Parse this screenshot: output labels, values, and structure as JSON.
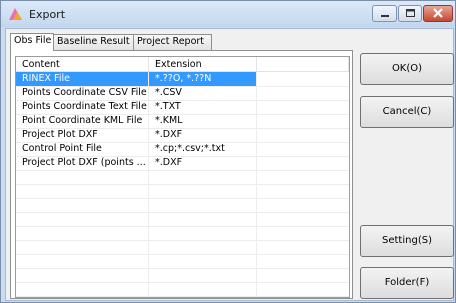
{
  "window": {
    "title": "Export"
  },
  "tabs": [
    "Obs File",
    "Baseline Result",
    "Project Report"
  ],
  "active_tab": 0,
  "list": {
    "columns": [
      "Content",
      "Extension"
    ],
    "rows": [
      {
        "content": "RINEX File",
        "extension": "*.??O, *.??N",
        "selected": true
      },
      {
        "content": "Points Coordinate CSV File",
        "extension": "*.CSV"
      },
      {
        "content": "Points Coordinate Text File",
        "extension": "*.TXT"
      },
      {
        "content": "Point Coordinate KML File",
        "extension": "*.KML"
      },
      {
        "content": "Project Plot DXF",
        "extension": "*.DXF"
      },
      {
        "content": "Control Point File",
        "extension": "*.cp;*.csv;*.txt"
      },
      {
        "content": "Project Plot DXF (points ...",
        "extension": "*.DXF"
      }
    ]
  },
  "buttons": {
    "ok": "OK(O)",
    "cancel": "Cancel(C)",
    "setting": "Setting(S)",
    "folder": "Folder(F)"
  },
  "colors": {
    "selection": "#3399ff",
    "titlebar": "#c8dcf2",
    "close": "#c5492f"
  }
}
